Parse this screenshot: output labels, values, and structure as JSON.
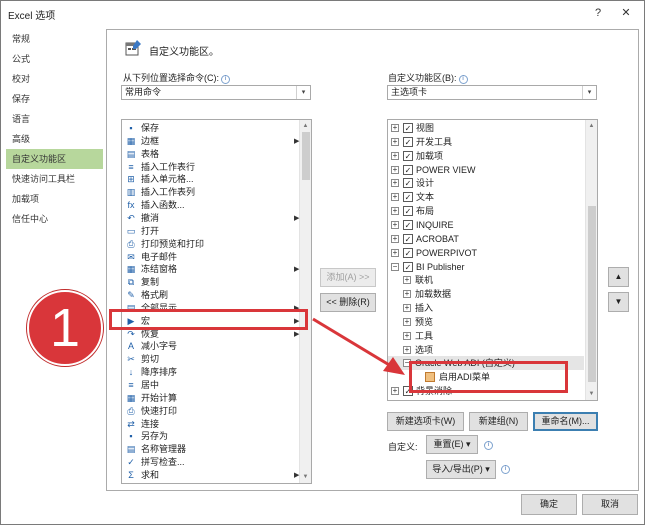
{
  "window": {
    "title": "Excel 选项",
    "help_glyph": "?",
    "close_glyph": "✕"
  },
  "nav": {
    "items": [
      {
        "label": "常规"
      },
      {
        "label": "公式"
      },
      {
        "label": "校对"
      },
      {
        "label": "保存"
      },
      {
        "label": "语言"
      },
      {
        "label": "高级"
      },
      {
        "label": "自定义功能区",
        "active": true
      },
      {
        "label": "快速访问工具栏"
      },
      {
        "label": "加载项"
      },
      {
        "label": "信任中心"
      }
    ]
  },
  "customize": {
    "title": "自定义功能区。",
    "choose_from_label": "从下列位置选择命令(C):",
    "choose_from_value": "常用命令",
    "customize_ribbon_label": "自定义功能区(B):",
    "customize_ribbon_value": "主选项卡",
    "info_glyph": "i"
  },
  "commands": [
    {
      "label": "保存",
      "icon": "save-icon",
      "glyph": "▪"
    },
    {
      "label": "边框",
      "icon": "border-icon",
      "glyph": "▦",
      "submenu": true
    },
    {
      "label": "表格",
      "icon": "table-icon",
      "glyph": "▤"
    },
    {
      "label": "插入工作表行",
      "icon": "insert-row-icon",
      "glyph": "≡"
    },
    {
      "label": "插入单元格...",
      "icon": "insert-cell-icon",
      "glyph": "⊞"
    },
    {
      "label": "插入工作表列",
      "icon": "insert-column-icon",
      "glyph": "▥"
    },
    {
      "label": "插入函数...",
      "icon": "function-icon",
      "glyph": "fx"
    },
    {
      "label": "撤消",
      "icon": "undo-icon",
      "glyph": "↶",
      "submenu": true
    },
    {
      "label": "打开",
      "icon": "open-folder-icon",
      "glyph": "▭"
    },
    {
      "label": "打印预览和打印",
      "icon": "print-preview-icon",
      "glyph": "⎙"
    },
    {
      "label": "电子邮件",
      "icon": "email-icon",
      "glyph": "✉"
    },
    {
      "label": "冻结窗格",
      "icon": "freeze-panes-icon",
      "glyph": "▦",
      "submenu": true
    },
    {
      "label": "复制",
      "icon": "copy-icon",
      "glyph": "⧉"
    },
    {
      "label": "格式刷",
      "icon": "format-painter-icon",
      "glyph": "✎"
    },
    {
      "label": "全部显示",
      "icon": "show-all-icon",
      "glyph": "▤",
      "submenu": true
    },
    {
      "label": "宏",
      "icon": "macro-icon",
      "glyph": "▶",
      "submenu": true
    },
    {
      "label": "恢复",
      "icon": "redo-icon",
      "glyph": "↷",
      "submenu": true
    },
    {
      "label": "减小字号",
      "icon": "decrease-font-icon",
      "glyph": "A"
    },
    {
      "label": "剪切",
      "icon": "cut-icon",
      "glyph": "✂"
    },
    {
      "label": "降序排序",
      "icon": "sort-descending-icon",
      "glyph": "↓"
    },
    {
      "label": "居中",
      "icon": "center-align-icon",
      "glyph": "≡"
    },
    {
      "label": "开始计算",
      "icon": "calculate-icon",
      "glyph": "▦"
    },
    {
      "label": "快速打印",
      "icon": "quick-print-icon",
      "glyph": "⎙"
    },
    {
      "label": "连接",
      "icon": "connections-icon",
      "glyph": "⇄"
    },
    {
      "label": "另存为",
      "icon": "save-as-icon",
      "glyph": "▪"
    },
    {
      "label": "名称管理器",
      "icon": "name-manager-icon",
      "glyph": "▤"
    },
    {
      "label": "拼写检查...",
      "icon": "spelling-icon",
      "glyph": "✓"
    },
    {
      "label": "求和",
      "icon": "sum-icon",
      "glyph": "Σ",
      "submenu": true
    }
  ],
  "middle_buttons": {
    "add": "添加(A) >>",
    "remove": "<< 删除(R)"
  },
  "tree": [
    {
      "label": "视图",
      "checked": true,
      "expander": "+",
      "level": 0
    },
    {
      "label": "开发工具",
      "checked": true,
      "expander": "+",
      "level": 0
    },
    {
      "label": "加载项",
      "checked": true,
      "expander": "+",
      "level": 0
    },
    {
      "label": "POWER VIEW",
      "checked": true,
      "expander": "+",
      "level": 0
    },
    {
      "label": "设计",
      "checked": true,
      "expander": "+",
      "level": 0
    },
    {
      "label": "文本",
      "checked": true,
      "expander": "+",
      "level": 0
    },
    {
      "label": "布局",
      "checked": true,
      "expander": "+",
      "level": 0
    },
    {
      "label": "INQUIRE",
      "checked": true,
      "expander": "+",
      "level": 0
    },
    {
      "label": "ACROBAT",
      "checked": true,
      "expander": "+",
      "level": 0
    },
    {
      "label": "POWERPIVOT",
      "checked": true,
      "expander": "+",
      "level": 0
    },
    {
      "label": "BI Publisher",
      "checked": true,
      "expander": "−",
      "level": 0
    },
    {
      "label": "联机",
      "expander": "+",
      "level": 1
    },
    {
      "label": "加载数据",
      "expander": "+",
      "level": 1
    },
    {
      "label": "插入",
      "expander": "+",
      "level": 1
    },
    {
      "label": "预览",
      "expander": "+",
      "level": 1
    },
    {
      "label": "工具",
      "expander": "+",
      "level": 1
    },
    {
      "label": "选项",
      "expander": "+",
      "level": 1
    },
    {
      "label": "Oracle Web ADI (自定义)",
      "expander": "−",
      "level": 1,
      "selected": true
    },
    {
      "label": "启用ADI菜单",
      "level": 2
    },
    {
      "label": "背景消除",
      "checked": true,
      "expander": "+",
      "level": 0
    }
  ],
  "tree_buttons": {
    "new_tab": "新建选项卡(W)",
    "new_group": "新建组(N)",
    "rename": "重命名(M)...",
    "customizations_label": "自定义:",
    "reset": "重置(E) ▾",
    "import_export": "导入/导出(P) ▾",
    "move_up": "▲",
    "move_down": "▼"
  },
  "footer": {
    "ok": "确定",
    "cancel": "取消"
  },
  "annotation": {
    "step_number": "1"
  },
  "colors": {
    "highlight": "#d9363a",
    "nav_active": "#b7d79c"
  }
}
